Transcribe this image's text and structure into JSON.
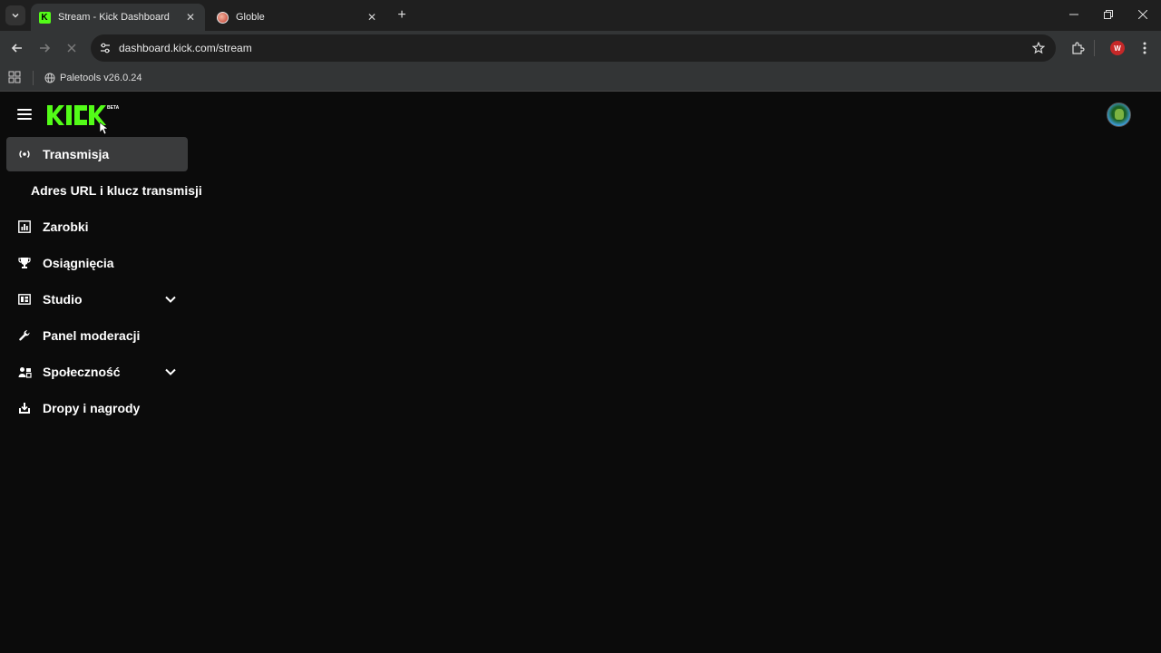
{
  "browser": {
    "tabs": [
      {
        "title": "Stream - Kick Dashboard",
        "favicon": "kick-icon",
        "active": true
      },
      {
        "title": "Globle",
        "favicon": "globle-icon",
        "active": false
      }
    ],
    "url": "dashboard.kick.com/stream",
    "bookmarks": [
      {
        "label": "Paletools v26.0.24",
        "icon": "globe-icon"
      }
    ],
    "profile_initial": "W"
  },
  "kick": {
    "logo_text": "KICK",
    "logo_badge": "BETA",
    "accent_color": "#53fc18"
  },
  "sidebar": {
    "items": [
      {
        "label": "Transmisja",
        "icon": "broadcast-icon",
        "active": true
      },
      {
        "label": "Adres URL i klucz transmisji",
        "sub": true
      },
      {
        "label": "Zarobki",
        "icon": "chart-icon"
      },
      {
        "label": "Osiągnięcia",
        "icon": "trophy-icon"
      },
      {
        "label": "Studio",
        "icon": "studio-icon",
        "expandable": true
      },
      {
        "label": "Panel moderacji",
        "icon": "wrench-icon"
      },
      {
        "label": "Społeczność",
        "icon": "community-icon",
        "expandable": true
      },
      {
        "label": "Dropy i nagrody",
        "icon": "drops-icon"
      }
    ]
  }
}
